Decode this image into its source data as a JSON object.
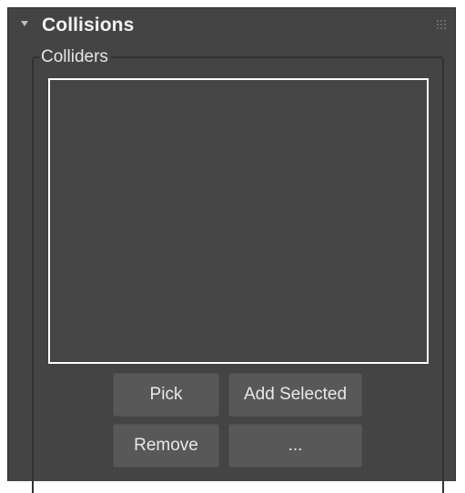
{
  "rollout": {
    "title": "Collisions",
    "collapse_icon": "triangle-down",
    "drag_icon": "grip-dots"
  },
  "colliders_group": {
    "label": "Colliders",
    "items": []
  },
  "buttons": {
    "pick": "Pick",
    "add_selected": "Add Selected",
    "remove": "Remove",
    "more": "..."
  },
  "colors": {
    "panel_bg": "#444444",
    "listbox_border": "#ffffff",
    "button_bg": "#585858",
    "text": "#f2f2f2"
  }
}
